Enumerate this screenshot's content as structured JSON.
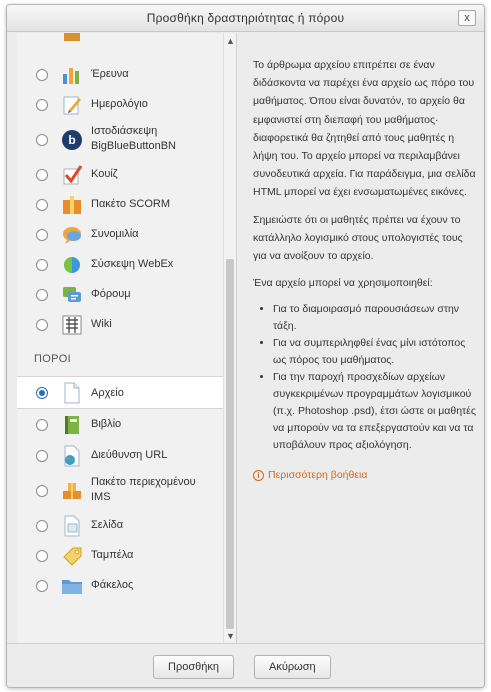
{
  "dialog": {
    "title": "Προσθήκη δραστηριότητας ή πόρου",
    "close_label": "x"
  },
  "list": {
    "activities": [
      {
        "label": "Έρευνα",
        "icon": "survey-icon"
      },
      {
        "label": "Ημερολόγιο",
        "icon": "journal-icon"
      },
      {
        "label": "Ιστοδιάσκεψη\nBigBlueButtonBN",
        "icon": "bigbluebutton-icon"
      },
      {
        "label": "Κουίζ",
        "icon": "quiz-icon"
      },
      {
        "label": "Πακέτο SCORM",
        "icon": "scorm-icon"
      },
      {
        "label": "Συνομιλία",
        "icon": "chat-icon"
      },
      {
        "label": "Σύσκεψη WebEx",
        "icon": "webex-icon"
      },
      {
        "label": "Φόρουμ",
        "icon": "forum-icon"
      },
      {
        "label": "Wiki",
        "icon": "wiki-icon"
      }
    ],
    "resources_heading": "ΠΟΡΟΙ",
    "resources": [
      {
        "label": "Αρχείο",
        "icon": "file-icon",
        "selected": true
      },
      {
        "label": "Βιβλίο",
        "icon": "book-icon"
      },
      {
        "label": "Διεύθυνση URL",
        "icon": "url-icon"
      },
      {
        "label": "Πακέτο περιεχομένου\nIMS",
        "icon": "ims-icon"
      },
      {
        "label": "Σελίδα",
        "icon": "page-icon"
      },
      {
        "label": "Ταμπέλα",
        "icon": "label-icon"
      },
      {
        "label": "Φάκελος",
        "icon": "folder-icon"
      }
    ]
  },
  "description": {
    "p1": "Το άρθρωμα αρχείου επιτρέπει σε έναν διδάσκοντα να παρέχει ένα αρχείο ως πόρο του μαθήματος. Όπου είναι δυνατόν, το αρχείο θα εμφανιστεί στη διεπαφή του μαθήματος· διαφορετικά θα ζητηθεί από τους μαθητές η λήψη του. Το αρχείο μπορεί να περιλαμβάνει συνοδευτικά αρχεία. Για παράδειγμα, μια σελίδα HTML μπορεί να έχει ενσωματωμένες εικόνες.",
    "p2": "Σημειώστε ότι οι μαθητές πρέπει να έχουν το κατάλληλο λογισμικό στους υπολογιστές τους για να ανοίξουν το αρχείο.",
    "p3": "Ένα αρχείο μπορεί να χρησιμοποιηθεί:",
    "uses": [
      "Για το διαμοιρασμό παρουσιάσεων στην τάξη.",
      "Για να συμπεριληφθεί ένας μίνι ιστότοπος ως πόρος του μαθήματος.",
      "Για την παροχή προσχεδίων αρχείων συγκεκριμένων προγραμμάτων λογισμικού (π.χ. Photoshop .psd), έτσι ώστε οι μαθητές να μπορούν να τα επεξεργαστούν και να τα υποβάλουν προς αξιολόγηση."
    ],
    "more_help": "Περισσότερη βοήθεια"
  },
  "footer": {
    "add_label": "Προσθήκη",
    "cancel_label": "Ακύρωση"
  },
  "colors": {
    "accent": "#2a6ebb",
    "link": "#d1681f"
  }
}
